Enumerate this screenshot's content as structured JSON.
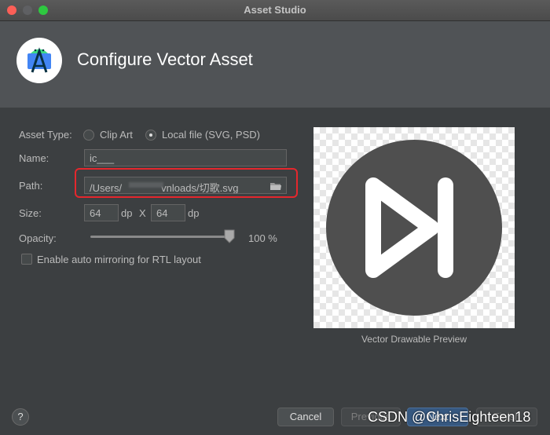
{
  "window": {
    "title": "Asset Studio"
  },
  "header": {
    "title": "Configure Vector Asset",
    "logo_icon": "android-studio-logo-icon"
  },
  "form": {
    "asset_type_label": "Asset Type:",
    "asset_type_options": [
      {
        "label": "Clip Art",
        "selected": false
      },
      {
        "label": "Local file (SVG, PSD)",
        "selected": true
      }
    ],
    "name_label": "Name:",
    "name_value": "ic___",
    "path_label": "Path:",
    "path_value_prefix": "/Users/",
    "path_value_suffix": "vnloads/切歌.svg",
    "path_browse_icon": "folder-icon",
    "size_label": "Size:",
    "width_value": "64",
    "height_value": "64",
    "dp_unit": "dp",
    "size_separator": "X",
    "opacity_label": "Opacity:",
    "opacity_value": "100 %",
    "opacity_level": 1.0,
    "rtl_label": "Enable auto mirroring for RTL layout",
    "rtl_checked": false,
    "highlight_color": "#e5272d"
  },
  "preview": {
    "caption": "Vector Drawable Preview",
    "icon": "skip-next-circle-icon",
    "icon_color": "#4f4f4f"
  },
  "footer": {
    "help_label": "?",
    "cancel_label": "Cancel",
    "previous_label": "Previous",
    "next_label": "Next",
    "finish_label": "Finish"
  },
  "watermark": {
    "text": "CSDN @ChrisEighteen18"
  },
  "colors": {
    "window_bg": "#3c3f41",
    "header_bg": "#505356",
    "primary_button": "#365880"
  }
}
